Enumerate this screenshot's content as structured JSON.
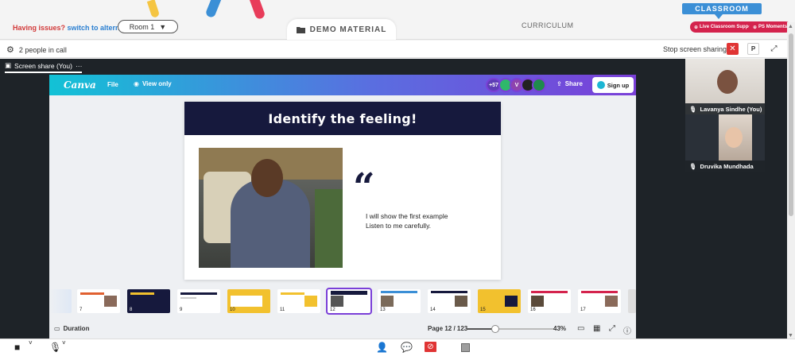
{
  "topbar": {
    "issues_question": "Having issues?",
    "issues_link": "switch to alternate room",
    "room_value": "Room 1",
    "demo_label": "DEMO MATERIAL",
    "curriculum_label": "CURRICULUM",
    "classroom_label": "CLASSROOM",
    "live_support_label": "Live Classroom Support",
    "ps_moments_label": "PS Moments"
  },
  "callbar": {
    "people_text": "2 people in call",
    "stop_share_label": "Stop screen sharing",
    "p_label": "P"
  },
  "share_tab": {
    "label": "Screen share (You)",
    "more": "···"
  },
  "canva": {
    "logo": "Canva",
    "file_label": "File",
    "view_label": "View only",
    "avatar_count": "+57",
    "avatar_letter": "V",
    "share_label": "Share",
    "signup_label": "Sign up",
    "slide": {
      "title": "Identify the feeling!",
      "quote_mark": "“",
      "line1": "I will show the first example",
      "line2": "Listen to me carefully."
    },
    "thumbnails": [
      {
        "num": "7"
      },
      {
        "num": "8"
      },
      {
        "num": "9"
      },
      {
        "num": "10"
      },
      {
        "num": "11"
      },
      {
        "num": "12"
      },
      {
        "num": "13"
      },
      {
        "num": "14"
      },
      {
        "num": "15"
      },
      {
        "num": "16"
      },
      {
        "num": "17"
      }
    ],
    "duration_label": "Duration",
    "page_label": "Page 12 / 123",
    "zoom_label": "43%",
    "zoom_fraction": 0.33
  },
  "participants": [
    {
      "name": "Lavanya Sindhe (You)"
    },
    {
      "name": "Druvika Mundhada"
    }
  ],
  "colors": {
    "accent_blue": "#3b8fd6",
    "accent_red": "#d4234d",
    "canva_purple": "#7a3fd8",
    "slide_navy": "#16193d"
  }
}
